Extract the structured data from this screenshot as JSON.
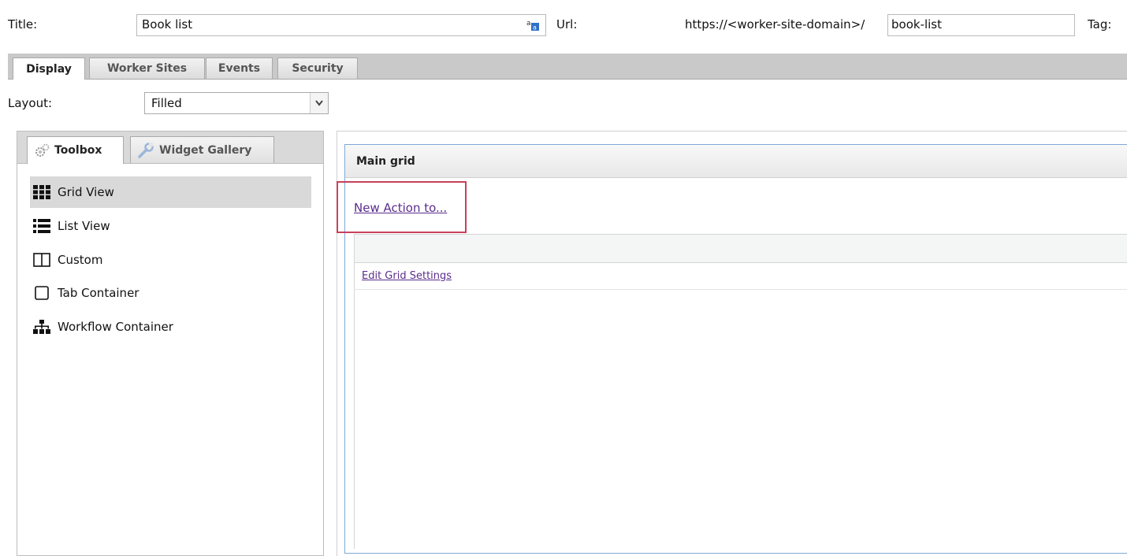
{
  "header": {
    "title_label": "Title:",
    "title_value": "Book list",
    "url_label": "Url:",
    "url_prefix": "https://<worker-site-domain>/",
    "url_value": "book-list",
    "tag_label": "Tag:"
  },
  "tabs": [
    {
      "label": "Display",
      "active": true
    },
    {
      "label": "Worker Sites",
      "active": false
    },
    {
      "label": "Events",
      "active": false
    },
    {
      "label": "Security",
      "active": false
    }
  ],
  "layout": {
    "label": "Layout:",
    "selected": "Filled"
  },
  "left_panel": {
    "tabs": [
      {
        "label": "Toolbox",
        "icon": "gear-icon",
        "active": true
      },
      {
        "label": "Widget Gallery",
        "icon": "wrench-icon",
        "active": false
      }
    ],
    "tools": [
      {
        "label": "Grid View",
        "icon": "grid-view-icon",
        "selected": true
      },
      {
        "label": "List View",
        "icon": "list-view-icon",
        "selected": false
      },
      {
        "label": "Custom",
        "icon": "custom-columns-icon",
        "selected": false
      },
      {
        "label": "Tab Container",
        "icon": "tab-container-icon",
        "selected": false
      },
      {
        "label": "Workflow Container",
        "icon": "workflow-icon",
        "selected": false
      }
    ]
  },
  "main_grid": {
    "title": "Main grid",
    "new_action_link": "New Action to...",
    "edit_settings_link": "Edit Grid Settings"
  },
  "colors": {
    "tab_strip": "#c9c9c9",
    "highlight_box": "#c8405a",
    "grid_border": "#7fa9d6",
    "link": "#5a2d8c"
  }
}
